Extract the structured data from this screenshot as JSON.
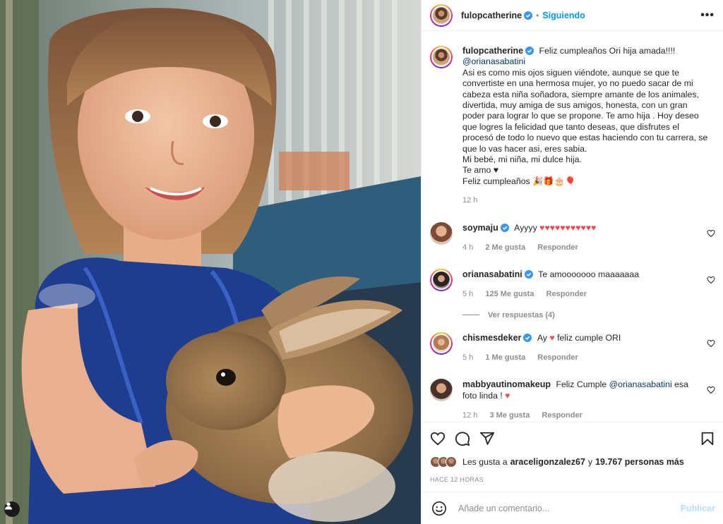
{
  "post": {
    "author": "fulopcatherine",
    "follow_status": "Siguiendo",
    "separator": "•",
    "more": "•••",
    "photo_alt": "Niña sosteniendo un conejo"
  },
  "caption": {
    "author": "fulopcatherine",
    "intro": "Feliz cumpleaños Ori hija amada!!!!",
    "mention": "@orianasabatini",
    "text": "Asi es como mis ojos siguen viéndote, aunque se que te convertiste en una hermosa mujer, yo no puedo sacar de mi cabeza esta niña soñadora, siempre amante de los animales, divertida, muy amiga de sus amigos, honesta, con un gran poder para lograr lo que se propone. Te amo hija . Hoy deseo que logres la felicidad que tanto deseas, que disfrutes el procesó de todo lo nuevo que estas haciendo con tu carrera, se que lo vas hacer asi, eres sabia.",
    "line2": "Mi bebé, mi niña, mi dulce hija.",
    "line3": "Te amo ♥",
    "line4": "Feliz cumpleaños 🎉🎁🎂🎈",
    "time": "12 h"
  },
  "comments": [
    {
      "user": "soymaju",
      "text": "Ayyyy",
      "hearts": "♥♥♥♥♥♥♥♥♥♥♥",
      "time": "4 h",
      "likes": "2 Me gusta",
      "reply": "Responder"
    },
    {
      "user": "orianasabatini",
      "text": "Te amooooooo maaaaaaa",
      "time": "5 h",
      "likes": "125 Me gusta",
      "reply": "Responder",
      "view_replies": "Ver respuestas (4)"
    },
    {
      "user": "chismesdeker",
      "text_pre": "Ay",
      "heart": "♥",
      "text_post": "feliz cumple ORI",
      "time": "5 h",
      "likes": "1 Me gusta",
      "reply": "Responder"
    },
    {
      "user": "mabbyautinomakeup",
      "text_pre": "Feliz Cumple",
      "mention": "@orianasabatini",
      "text_post": "esa foto linda !",
      "heart": "♥",
      "time": "12 h",
      "likes": "3 Me gusta",
      "reply": "Responder"
    }
  ],
  "likes": {
    "prefix": "Les gusta a",
    "user": "araceligonzalez67",
    "connector": "y",
    "count": "19.767 personas más"
  },
  "posted": "HACE 12 HORAS",
  "add_comment": {
    "placeholder": "Añade un comentario...",
    "publish": "Publicar"
  },
  "colors": {
    "accent": "#0095f6",
    "heart": "#ed4956",
    "muted": "#8e8e8e",
    "publish_disabled": "#b2dffc"
  }
}
